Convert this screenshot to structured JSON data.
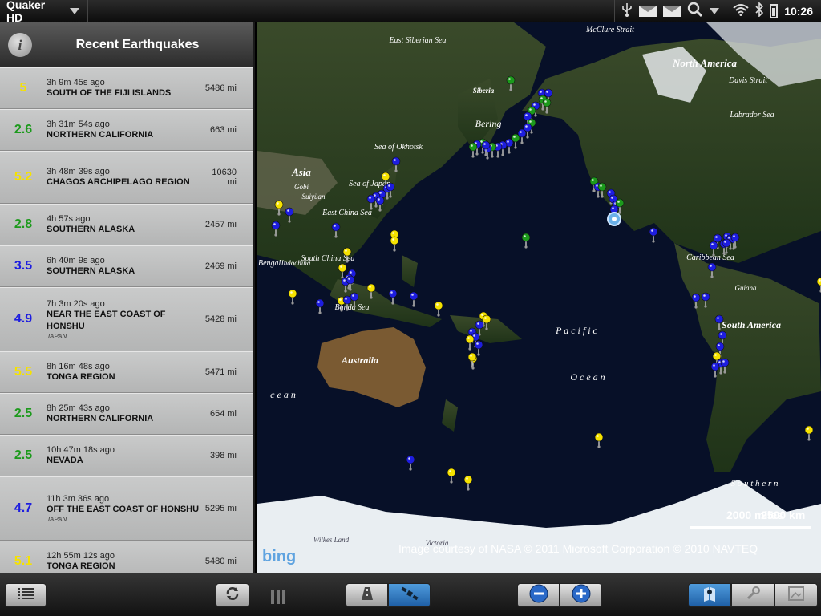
{
  "status_bar": {
    "app_name": "Quaker HD",
    "time": "10:26"
  },
  "sidebar": {
    "title": "Recent Earthquakes",
    "info_icon": "i",
    "quakes": [
      {
        "magnitude": "5",
        "color": "#f5e200",
        "ago": "3h 9m 45s ago",
        "place": "SOUTH OF THE FIJI ISLANDS",
        "region": "",
        "distance": "5486 mi"
      },
      {
        "magnitude": "2.6",
        "color": "#1c9a1c",
        "ago": "3h 31m 54s ago",
        "place": "NORTHERN CALIFORNIA",
        "region": "",
        "distance": "663 mi"
      },
      {
        "magnitude": "5.2",
        "color": "#f5e200",
        "ago": "3h 48m 39s ago",
        "place": "CHAGOS ARCHIPELAGO REGION",
        "region": "",
        "distance": "10630 mi"
      },
      {
        "magnitude": "2.8",
        "color": "#1c9a1c",
        "ago": "4h 57s ago",
        "place": "SOUTHERN ALASKA",
        "region": "",
        "distance": "2457 mi"
      },
      {
        "magnitude": "3.5",
        "color": "#1d1de0",
        "ago": "6h 40m 9s ago",
        "place": "SOUTHERN ALASKA",
        "region": "",
        "distance": "2469 mi"
      },
      {
        "magnitude": "4.9",
        "color": "#1d1de0",
        "ago": "7h 3m 20s ago",
        "place": "NEAR THE EAST COAST OF HONSHU",
        "region": "JAPAN",
        "distance": "5428 mi"
      },
      {
        "magnitude": "5.5",
        "color": "#f5e200",
        "ago": "8h 16m 48s ago",
        "place": "TONGA REGION",
        "region": "",
        "distance": "5471 mi"
      },
      {
        "magnitude": "2.5",
        "color": "#1c9a1c",
        "ago": "8h 25m 43s ago",
        "place": "NORTHERN CALIFORNIA",
        "region": "",
        "distance": "654 mi"
      },
      {
        "magnitude": "2.5",
        "color": "#1c9a1c",
        "ago": "10h 47m 18s ago",
        "place": "NEVADA",
        "region": "",
        "distance": "398 mi"
      },
      {
        "magnitude": "4.7",
        "color": "#1d1de0",
        "ago": "11h 3m 36s ago",
        "place": "OFF THE EAST COAST OF HONSHU",
        "region": "JAPAN",
        "distance": "5295 mi"
      },
      {
        "magnitude": "5.1",
        "color": "#f5e200",
        "ago": "12h 55m 12s ago",
        "place": "TONGA REGION",
        "region": "",
        "distance": "5480 mi"
      }
    ]
  },
  "map": {
    "labels": {
      "east_siberian_sea": "East Siberian Sea",
      "mcclure_strait": "McClure Strait",
      "north_america": "North America",
      "davis_strait": "Davis Strait",
      "labrador_sea": "Labrador Sea",
      "siberia": "Siberia",
      "bering": "Bering",
      "sea_of_okhotsk": "Sea of Okhotsk",
      "asia": "Asia",
      "gobi": "Gobi",
      "sulyuan": "Suiyüan",
      "sea_of_japan": "Sea of Japan",
      "east_china_sea": "East China Sea",
      "south_china_sea": "South China Sea",
      "indochina": "Indochina",
      "of_bengal": "of Bengal",
      "banda_sea": "Banda Sea",
      "australia": "Australia",
      "pacific": "P a c i f i c",
      "ocean": "O c e a n",
      "ocean_left": "c e a n",
      "caribbean_sea": "Caribbean Sea",
      "guiana": "Guiana",
      "south_america": "South America",
      "southern": "S o u t h e r n",
      "wilkes_land": "Wilkes Land",
      "victoria": "Victoria"
    },
    "scale_miles": "2000 miles",
    "scale_km": "2500 km",
    "copyright": "Image courtesy of NASA   © 2011 Microsoft Corporation   © 2010 NAVTEQ",
    "bing_logo": "bing",
    "markers": [
      {
        "color": "#1c9a1c",
        "count": 18
      },
      {
        "color": "#1d1de0",
        "count": 70
      },
      {
        "color": "#f5e200",
        "count": 22
      }
    ]
  },
  "bottom_bar": {
    "list_icon": "list-icon",
    "refresh_icon": "refresh-icon",
    "road_view_icon": "road-icon",
    "satellite_view_icon": "satellite-icon",
    "zoom_out_icon": "zoom-out-icon",
    "zoom_in_icon": "zoom-in-icon",
    "locate_icon": "map-pin-icon",
    "tools_icon": "wrench-icon",
    "photo_icon": "photo-icon"
  }
}
